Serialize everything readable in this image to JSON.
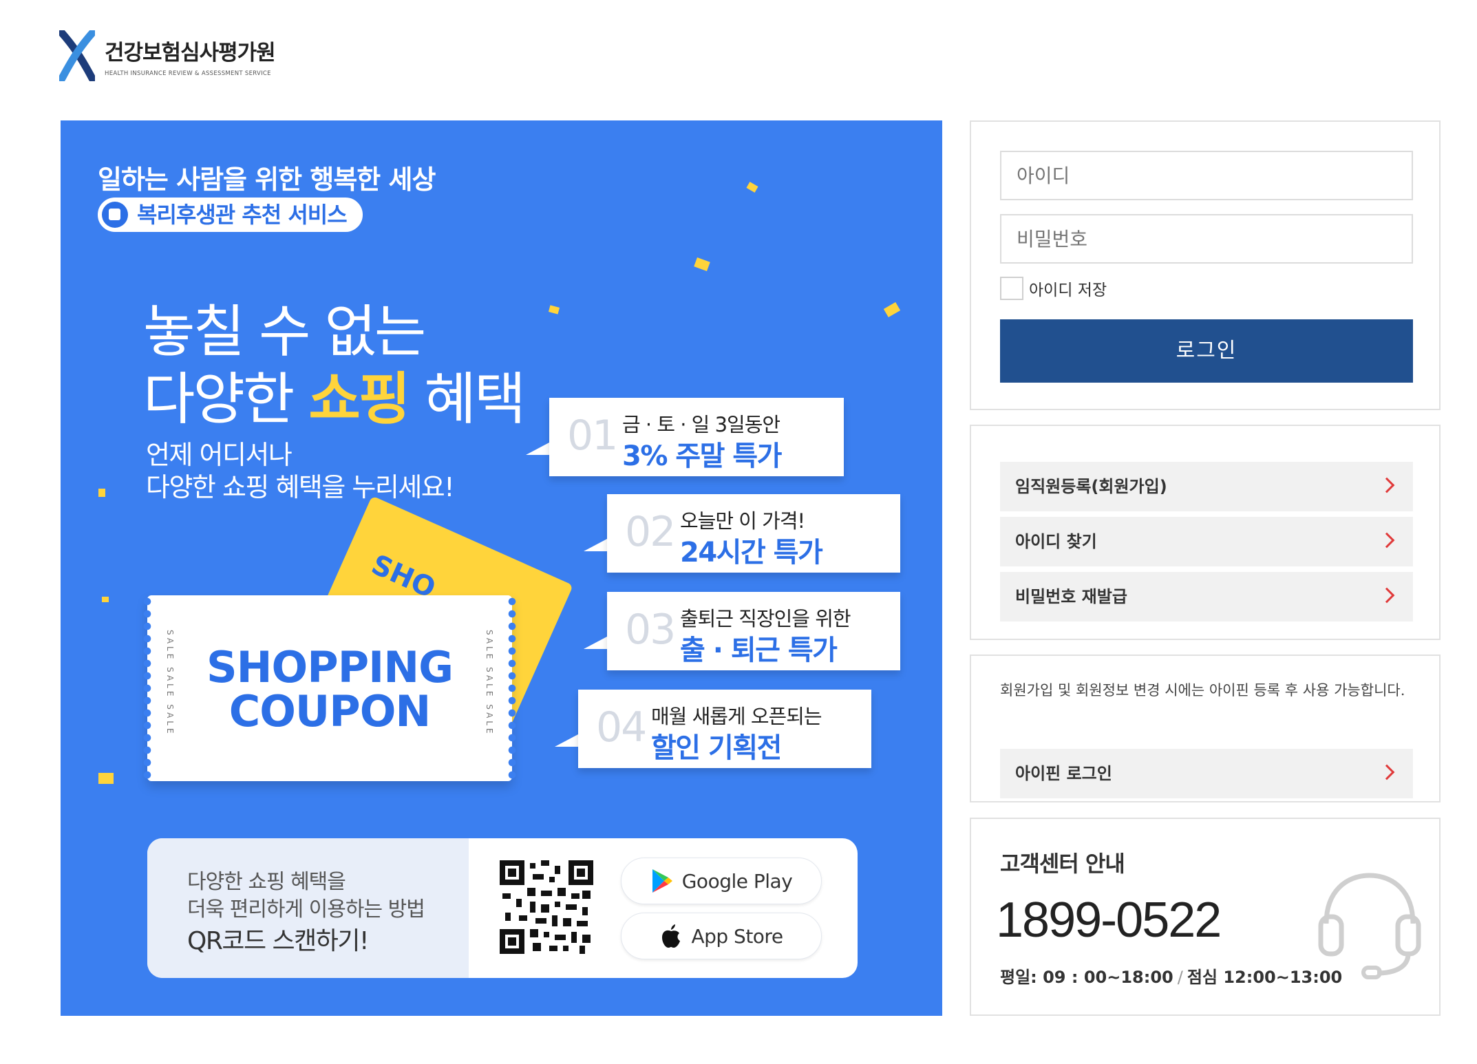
{
  "header": {
    "org_name": "건강보험심사평가원",
    "org_name_en": "HEALTH INSURANCE REVIEW & ASSESSMENT SERVICE"
  },
  "banner": {
    "tagline": "일하는 사람을 위한 행복한 세상",
    "pill_label": "복리후생관 추천 서비스",
    "headline_line1": "놓칠 수 없는",
    "headline_line2_pre": "다양한 ",
    "headline_line2_hl": "쇼핑",
    "headline_line2_post": " 혜택",
    "sub_line1": "언제 어디서나",
    "sub_line2": "다양한 쇼핑 혜택을 누리세요!",
    "cards": [
      {
        "num": "01",
        "line1": "금 · 토 · 일 3일동안",
        "line2": "3% 주말 특가"
      },
      {
        "num": "02",
        "line1": "오늘만 이 가격!",
        "line2": "24시간 특가"
      },
      {
        "num": "03",
        "line1": "출퇴근 직장인을 위한",
        "line2": "출 · 퇴근 특가"
      },
      {
        "num": "04",
        "line1": "매월 새롭게 오픈되는",
        "line2": "할인 기획전"
      }
    ],
    "ticket_line1": "SHOPPING",
    "ticket_line2": "COUPON",
    "ticket_back_text": "SHO",
    "ticket_side": "SALE SALE SALE",
    "qr_line1": "다양한 쇼핑 혜택을",
    "qr_line2": "더욱 편리하게 이용하는 방법",
    "qr_line3": "QR코드 스캔하기!",
    "google_play": "Google Play",
    "app_store": "App Store",
    "color_bg": "#3b7ff0",
    "color_highlight": "#ffd43b"
  },
  "login": {
    "id_placeholder": "아이디",
    "pw_placeholder": "비밀번호",
    "save_id_label": "아이디 저장",
    "login_button": "로그인",
    "button_color": "#21508f"
  },
  "links": {
    "register": "임직원등록(회원가입)",
    "find_id": "아이디 찾기",
    "reset_pw": "비밀번호 재발급"
  },
  "ipin": {
    "note": "회원가입 및 회원정보 변경 시에는 아이핀 등록 후 사용 가능합니다.",
    "login_label": "아이핀 로그인"
  },
  "customer_center": {
    "title": "고객센터 안내",
    "phone": "1899-0522",
    "weekday_hours": "평일: 09 : 00~18:00",
    "separator": "/",
    "lunch_hours": "점심 12:00~13:00",
    "icon": "headset-icon"
  }
}
